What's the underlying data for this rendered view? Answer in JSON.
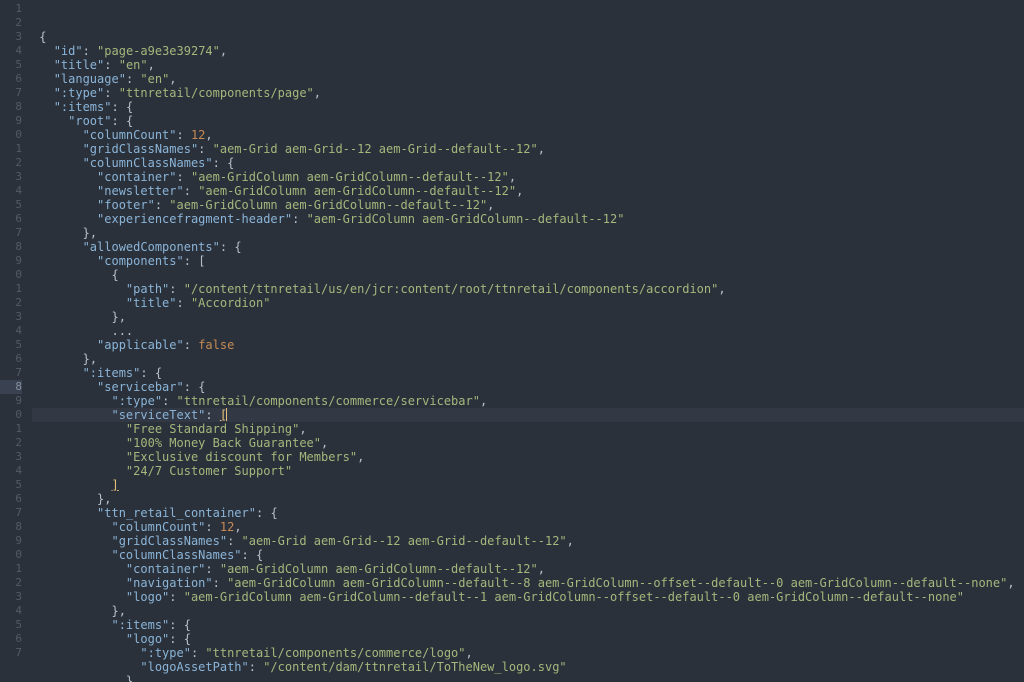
{
  "source": {
    "id": "page-a9e3e39274",
    "title": "en",
    "language": "en",
    "type": "ttnretail/components/page",
    "root": {
      "columnCount": 12,
      "gridClassNames": "aem-Grid aem-Grid--12 aem-Grid--default--12",
      "columnClassNames": {
        "container": "aem-GridColumn aem-GridColumn--default--12",
        "newsletter": "aem-GridColumn aem-GridColumn--default--12",
        "footer": "aem-GridColumn aem-GridColumn--default--12",
        "experiencefragment-header": "aem-GridColumn aem-GridColumn--default--12"
      },
      "allowedComponents": {
        "component": {
          "path": "/content/ttnretail/us/en/jcr:content/root/ttnretail/components/accordion",
          "title": "Accordion"
        },
        "applicable": false
      },
      "servicebar": {
        "type": "ttnretail/components/commerce/servicebar",
        "serviceText": [
          "Free Standard Shipping",
          "100% Money Back Guarantee",
          "Exclusive discount for Members",
          "24/7 Customer Support"
        ]
      },
      "ttn_retail_container": {
        "columnCount": 12,
        "gridClassNames": "aem-Grid aem-Grid--12 aem-Grid--default--12",
        "columnClassNames": {
          "container": "aem-GridColumn aem-GridColumn--default--12",
          "navigation": "aem-GridColumn aem-GridColumn--default--8 aem-GridColumn--offset--default--0 aem-GridColumn--default--none",
          "logo": "aem-GridColumn aem-GridColumn--default--1 aem-GridColumn--offset--default--0 aem-GridColumn--default--none"
        },
        "logo": {
          "type": "ttnretail/components/commerce/logo",
          "logoAssetPath": "/content/dam/ttnretail/ToTheNew_logo.svg"
        }
      }
    }
  },
  "lineNumbers": {
    "start": 1,
    "count": 47,
    "current": 28
  }
}
